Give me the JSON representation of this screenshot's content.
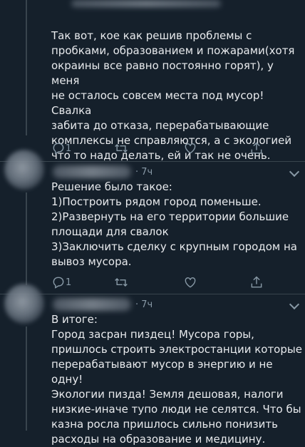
{
  "tweets": [
    {
      "text": "Так вот, кое как решив проблемы с\nпробками, образованием и пожарами(хотя\nокраины все равно постоянно горят), у меня\nне осталось совсем места под мусор! Свалка\nзабита до отказа, перерабатывающие\nкомплексы не справляются, а с экологией\nчто то надо делать, ей и так не очень.",
      "reply_count": "1"
    },
    {
      "time": "· 7ч",
      "text": "Решение было такое:\n1)Построить рядом город поменьше.\n2)Развернуть на его территории большие\nплощади для свалок\n3)Заключить сделку с крупным городом на\nвывоз мусора.",
      "reply_count": "1"
    },
    {
      "time": "· 7ч",
      "text": "В итоге:\nГород засран пиздец! Мусора горы,\nпришлось строить электростанции которые\nперерабатывают мусор в энергию и не одну!\nЭкологии пизда! Земля дешовая, налоги\nнизкие-иначе тупо люди не селятся. Что бы\nказна росла пришлось сильно понизить\nрасходы на образование и медицину."
    }
  ],
  "icons": [
    "reply-icon",
    "retweet-icon",
    "like-icon",
    "share-icon",
    "chevron-down-icon"
  ],
  "colors": {
    "background": "#15202b",
    "text": "#e8eaed",
    "muted": "#8899a6",
    "divider": "#38444d"
  }
}
